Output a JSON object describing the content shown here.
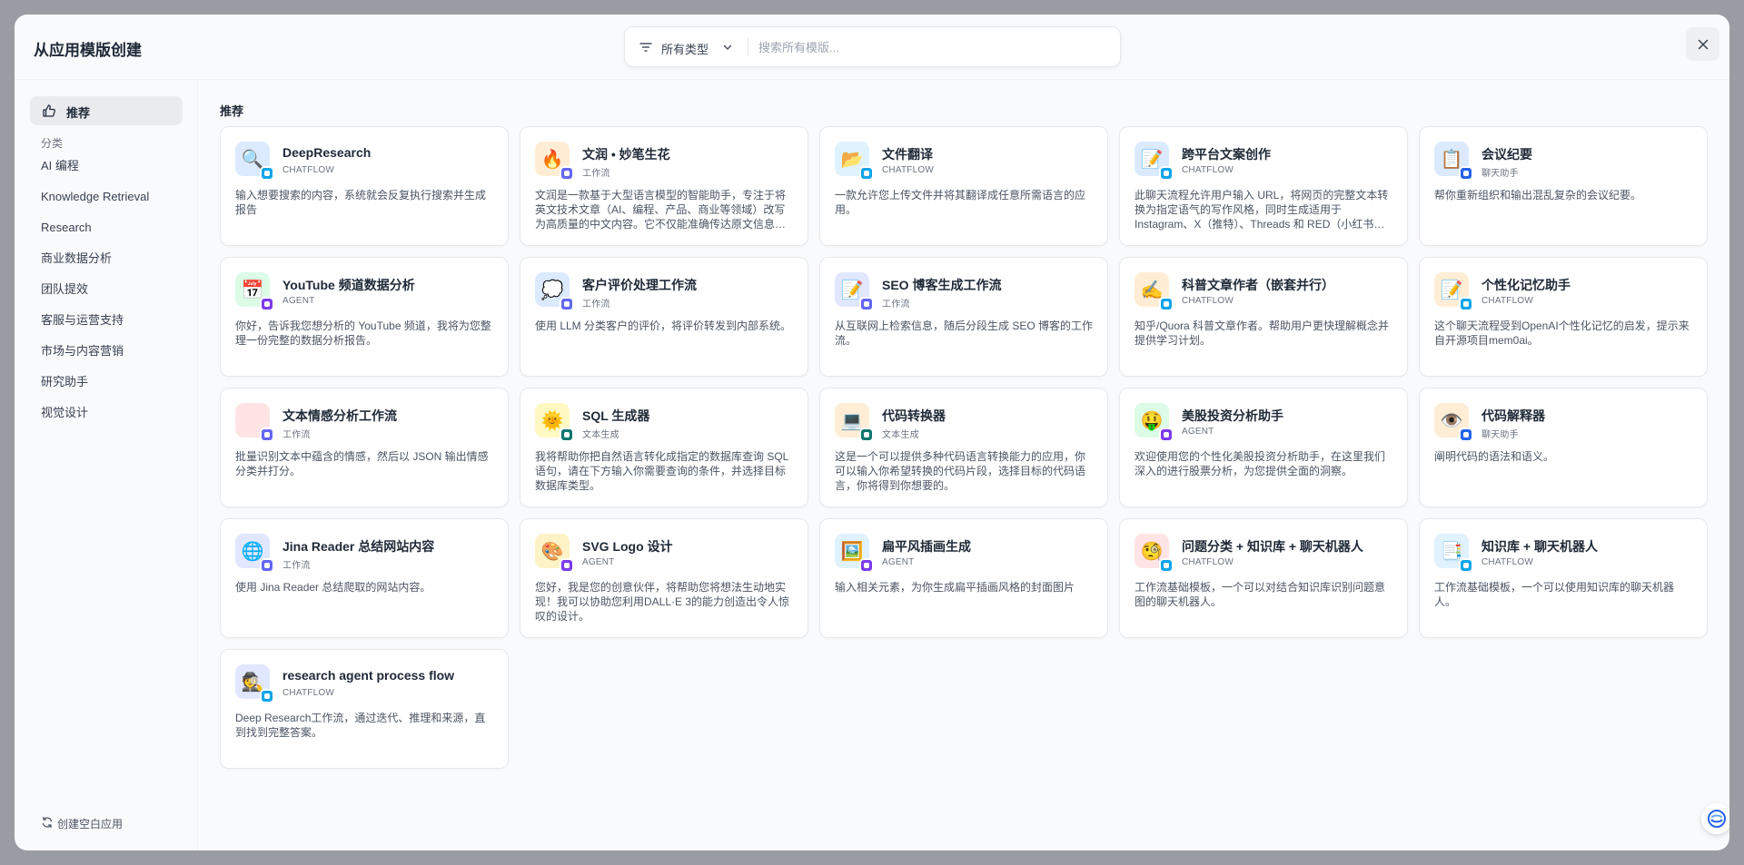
{
  "header": {
    "title": "从应用模版创建",
    "filter_label": "所有类型",
    "search_placeholder": "搜索所有模版..."
  },
  "sidebar": {
    "recommend_label": "推荐",
    "section_label": "分类",
    "categories": [
      "AI 编程",
      "Knowledge Retrieval",
      "Research",
      "商业数据分析",
      "团队提效",
      "客服与运营支持",
      "市场与内容营销",
      "研究助手",
      "视觉设计"
    ],
    "create_blank_label": "创建空白应用"
  },
  "main": {
    "title": "推荐",
    "cards": [
      {
        "name": "DeepResearch",
        "type": "CHATFLOW",
        "desc": "输入想要搜索的内容，系统就会反复执行搜索并生成报告",
        "emoji": "🔍",
        "bg": "#dbeafe",
        "badge": "chat"
      },
      {
        "name": "文润 • 妙笔生花",
        "type": "工作流",
        "desc": "文润是一款基于大型语言模型的智能助手，专注于将英文技术文章（AI、编程、产品、商业等领域）改写为高质量的中文内容。它不仅能准确传达原文信息，还能进行润色与优化。",
        "emoji": "🔥",
        "bg": "#ffedd5",
        "badge": "flow"
      },
      {
        "name": "文件翻译",
        "type": "CHATFLOW",
        "desc": "一款允许您上传文件并将其翻译成任意所需语言的应用。",
        "emoji": "📂",
        "bg": "#e0f2fe",
        "badge": "chat"
      },
      {
        "name": "跨平台文案创作",
        "type": "CHATFLOW",
        "desc": "此聊天流程允许用户输入 URL，将网页的完整文本转换为指定语气的写作风格，同时生成适用于 Instagram、X（推特）、Threads 和 RED（小红书）的文案。",
        "emoji": "📝",
        "bg": "#dbeafe",
        "badge": "chat"
      },
      {
        "name": "会议纪要",
        "type": "聊天助手",
        "desc": "帮你重新组织和输出混乱复杂的会议纪要。",
        "emoji": "📋",
        "bg": "#dbeafe",
        "badge": "assistant"
      },
      {
        "name": "YouTube 频道数据分析",
        "type": "AGENT",
        "desc": "你好，告诉我您想分析的 YouTube 频道，我将为您整理一份完整的数据分析报告。",
        "emoji": "📅",
        "bg": "#dcfce7",
        "badge": "agent"
      },
      {
        "name": "客户评价处理工作流",
        "type": "工作流",
        "desc": "使用 LLM 分类客户的评价，将评价转发到内部系统。",
        "emoji": "💭",
        "bg": "#dbeafe",
        "badge": "flow"
      },
      {
        "name": "SEO 博客生成工作流",
        "type": "工作流",
        "desc": "从互联网上检索信息，随后分段生成 SEO 博客的工作流。",
        "emoji": "📝",
        "bg": "#e0e7ff",
        "badge": "flow"
      },
      {
        "name": "科普文章作者（嵌套并行）",
        "type": "CHATFLOW",
        "desc": "知乎/Quora 科普文章作者。帮助用户更快理解概念并提供学习计划。",
        "emoji": "✍️",
        "bg": "#ffedd5",
        "badge": "chat"
      },
      {
        "name": "个性化记忆助手",
        "type": "CHATFLOW",
        "desc": "这个聊天流程受到OpenAI个性化记忆的启发，提示来自开源项目mem0ai。",
        "emoji": "📝",
        "bg": "#ffedd5",
        "badge": "chat"
      },
      {
        "name": "文本情感分析工作流",
        "type": "工作流",
        "desc": "批量识别文本中蕴含的情感，然后以 JSON 输出情感分类并打分。",
        "emoji": "",
        "bg": "#ffe4e6",
        "badge": "flow"
      },
      {
        "name": "SQL 生成器",
        "type": "文本生成",
        "desc": "我将帮助你把自然语言转化成指定的数据库查询 SQL 语句，请在下方输入你需要查询的条件，并选择目标数据库类型。",
        "emoji": "🌞",
        "bg": "#fef9c3",
        "badge": "text"
      },
      {
        "name": "代码转换器",
        "type": "文本生成",
        "desc": "这是一个可以提供多种代码语言转换能力的应用，你可以输入你希望转换的代码片段，选择目标的代码语言，你将得到你想要的。",
        "emoji": "💻",
        "bg": "#ffedd5",
        "badge": "text"
      },
      {
        "name": "美股投资分析助手",
        "type": "AGENT",
        "desc": "欢迎使用您的个性化美股投资分析助手，在这里我们深入的进行股票分析，为您提供全面的洞察。",
        "emoji": "🤑",
        "bg": "#dcfce7",
        "badge": "agent"
      },
      {
        "name": "代码解释器",
        "type": "聊天助手",
        "desc": "阐明代码的语法和语义。",
        "emoji": "👁️",
        "bg": "#ffedd5",
        "badge": "assistant"
      },
      {
        "name": "Jina Reader 总结网站内容",
        "type": "工作流",
        "desc": "使用 Jina Reader 总结爬取的网站内容。",
        "emoji": "🌐",
        "bg": "#e0e7ff",
        "badge": "flow"
      },
      {
        "name": "SVG Logo 设计",
        "type": "AGENT",
        "desc": "您好，我是您的创意伙伴，将帮助您将想法生动地实现！我可以协助您利用DALL·E 3的能力创造出令人惊叹的设计。",
        "emoji": "🎨",
        "bg": "#fef3c7",
        "badge": "agent"
      },
      {
        "name": "扁平风插画生成",
        "type": "AGENT",
        "desc": "输入相关元素，为你生成扁平插画风格的封面图片",
        "emoji": "🖼️",
        "bg": "#e0f2fe",
        "badge": "agent"
      },
      {
        "name": "问题分类 + 知识库 + 聊天机器人",
        "type": "CHATFLOW",
        "desc": "工作流基础模板，一个可以对结合知识库识别问题意图的聊天机器人。",
        "emoji": "🧐",
        "bg": "#ffe4e6",
        "badge": "chat"
      },
      {
        "name": "知识库 + 聊天机器人",
        "type": "CHATFLOW",
        "desc": "工作流基础模板，一个可以使用知识库的聊天机器人。",
        "emoji": "📑",
        "bg": "#e0f2fe",
        "badge": "chat"
      },
      {
        "name": "research agent process flow",
        "type": "CHATFLOW",
        "desc": "Deep Research工作流，通过迭代、推理和来源，直到找到完整答案。",
        "emoji": "🕵️",
        "bg": "#e0e7ff",
        "badge": "chat"
      }
    ]
  },
  "badge_colors": {
    "chat": "#0ea5e9",
    "flow": "#6366f1",
    "assistant": "#2563eb",
    "agent": "#7c3aed",
    "text": "#0f766e"
  },
  "icons": {
    "filter": "filter-icon",
    "chevron": "chevron-down-icon",
    "close": "close-icon",
    "recommend": "thumbs-up-icon",
    "create": "refresh-arrow-icon",
    "help": "help-chat-icon"
  }
}
